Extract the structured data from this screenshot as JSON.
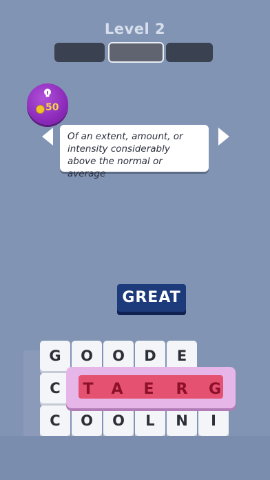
{
  "header": {
    "level_title": "Level 2"
  },
  "progress": {
    "total": 3,
    "current": 2
  },
  "hint": {
    "cost": "50",
    "icon": "lightbulb-icon",
    "coin_icon": "coin-icon"
  },
  "clue": {
    "text": "Of an extent, amount, or intensity considerably above the normal or average"
  },
  "answer": {
    "word": "GREAT"
  },
  "grid": {
    "rows": [
      [
        "G",
        "O",
        "O",
        "D",
        "E"
      ],
      [
        "C",
        "",
        "",
        "",
        "",
        ""
      ],
      [
        "C",
        "O",
        "O",
        "L",
        "N",
        "I"
      ]
    ]
  },
  "overlay": {
    "letters": [
      "T",
      "A",
      "E",
      "R",
      "G"
    ]
  },
  "colors": {
    "background": "#8194b4",
    "answer_bg": "#1d3a7a",
    "hint_purple": "#8a29b8",
    "overlay_pink": "#e6b6e9",
    "overlay_red": "#e55170"
  }
}
